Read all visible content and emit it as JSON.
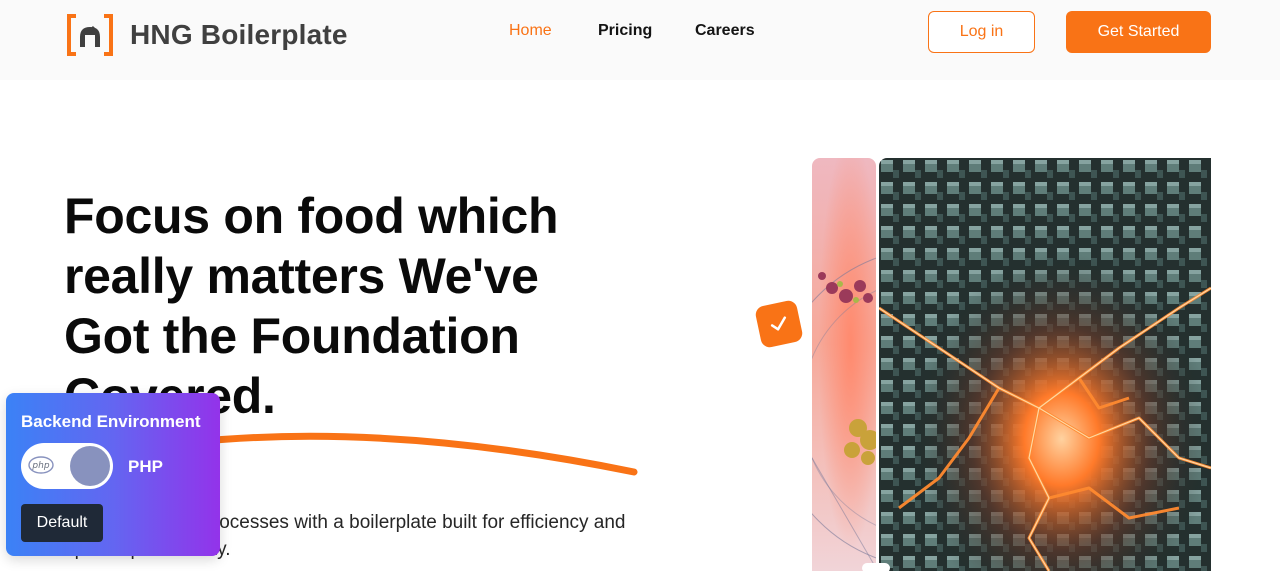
{
  "header": {
    "brand": "HNG Boilerplate",
    "nav": [
      {
        "label": "Home",
        "active": true
      },
      {
        "label": "Pricing",
        "active": false
      },
      {
        "label": "Careers",
        "active": false
      }
    ],
    "login_label": "Log in",
    "get_started_label": "Get Started"
  },
  "hero": {
    "title": "Focus on food which really matters We've Got the Foundation Covered.",
    "subtitle": "Streamline your processes with a boilerplate built for efficiency and optimal productivity."
  },
  "backend_env": {
    "title": "Backend Environment",
    "language": "PHP",
    "php_logo_text": "php",
    "default_label": "Default"
  },
  "colors": {
    "accent": "#f97316",
    "header_bg": "#fafafa",
    "widget_gradient_start": "#3b82f6",
    "widget_gradient_end": "#9333ea",
    "php_knob": "#8892be"
  },
  "icons": {
    "logo": "hng-bracket-logo",
    "badge": "check-icon",
    "php": "php-logo-icon"
  }
}
